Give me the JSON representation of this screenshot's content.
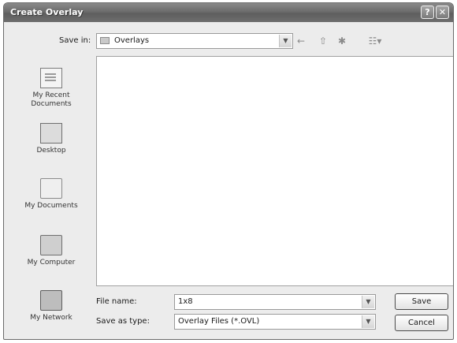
{
  "window": {
    "title": "Create Overlay",
    "help_button": "?",
    "close_button": "✕"
  },
  "save_in": {
    "label": "Save in:",
    "folder": "Overlays"
  },
  "places": [
    {
      "label": "My Recent Documents",
      "icon": "recent-documents-icon"
    },
    {
      "label": "Desktop",
      "icon": "desktop-icon"
    },
    {
      "label": "My Documents",
      "icon": "my-documents-icon"
    },
    {
      "label": "My Computer",
      "icon": "my-computer-icon"
    },
    {
      "label": "My Network",
      "icon": "my-network-icon"
    }
  ],
  "file_name": {
    "label": "File name:",
    "value": "1x8"
  },
  "save_as_type": {
    "label": "Save as type:",
    "value": "Overlay Files (*.OVL)"
  },
  "buttons": {
    "save": "Save",
    "cancel": "Cancel"
  }
}
